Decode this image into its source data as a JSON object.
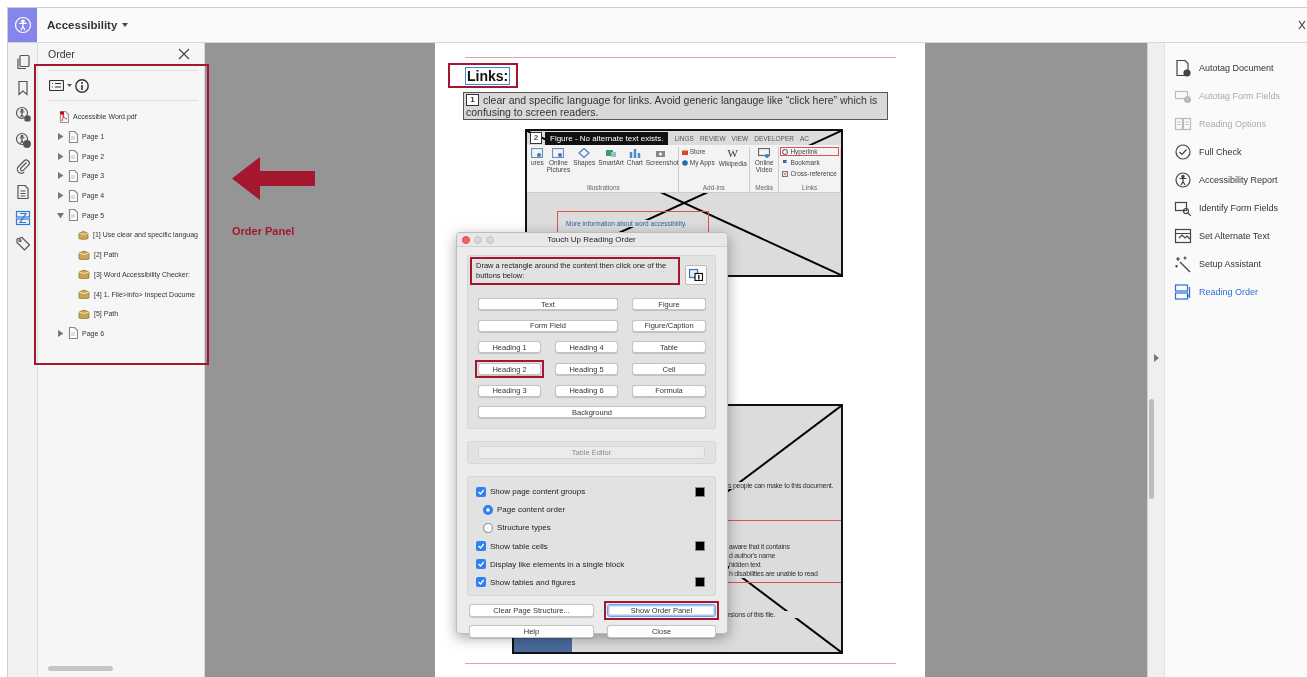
{
  "app_bar": {
    "title": "Accessibility"
  },
  "tool_rail": [
    {
      "kind": "pages",
      "selected": false
    },
    {
      "kind": "bookmarks",
      "selected": false
    },
    {
      "kind": "accessibility_tags",
      "selected": false
    },
    {
      "kind": "accessibility_check",
      "selected": false
    },
    {
      "kind": "attachments",
      "selected": false
    },
    {
      "kind": "content",
      "selected": false
    },
    {
      "kind": "order",
      "selected": true
    },
    {
      "kind": "tags",
      "selected": false
    }
  ],
  "order_panel": {
    "title": "Order",
    "highlighted": true,
    "tree": [
      {
        "kind": "file",
        "label": "Accessible Word.pdf",
        "children": [
          {
            "kind": "page",
            "label": "Page 1",
            "expanded": false
          },
          {
            "kind": "page",
            "label": "Page 2",
            "expanded": false
          },
          {
            "kind": "page",
            "label": "Page 3",
            "expanded": false
          },
          {
            "kind": "page",
            "label": "Page 4",
            "expanded": false
          },
          {
            "kind": "page",
            "label": "Page 5",
            "expanded": true,
            "children": [
              {
                "kind": "content",
                "label": "[1] Use clear and specific languag"
              },
              {
                "kind": "content",
                "label": "[2] Path"
              },
              {
                "kind": "content",
                "label": "[3] Word Accessibility Checker:"
              },
              {
                "kind": "content",
                "label": "[4] 1. File>Info> Inspect Docume"
              },
              {
                "kind": "content",
                "label": "[5] Path"
              }
            ]
          },
          {
            "kind": "page",
            "label": "Page 6",
            "expanded": false
          }
        ]
      }
    ]
  },
  "annotation": {
    "label": "Order Panel"
  },
  "document": {
    "heading": {
      "text": "Links:",
      "highlighted": true
    },
    "paragraph": {
      "number": "1",
      "text": "clear and specific language for links. Avoid generic langauge like “click here” which is confusing to screen readers."
    },
    "figure_1": {
      "number": "2",
      "tooltip": "Figure - No alternate text exists.",
      "tabs": [
        "LINGS",
        "REVIEW",
        "VIEW",
        "DEVELOPER",
        "AC"
      ],
      "groups": [
        {
          "label": "Illustrations",
          "buttons": [
            {
              "kind": "pictures",
              "label": "ures",
              "highlighted": false
            },
            {
              "kind": "pictures",
              "label": "Online Pictures",
              "highlighted": false
            },
            {
              "kind": "shapes",
              "label": "Shapes",
              "highlighted": false
            },
            {
              "kind": "smartart",
              "label": "SmartArt",
              "highlighted": false
            },
            {
              "kind": "chart",
              "label": "Chart",
              "highlighted": false
            },
            {
              "kind": "screenshot",
              "label": "Screenshot",
              "highlighted": false
            }
          ]
        },
        {
          "label": "Add-ins",
          "buttons": [
            {
              "kind": "store",
              "label": "Store",
              "highlighted": false
            },
            {
              "kind": "apps",
              "label": "My Apps",
              "highlighted": false
            },
            {
              "kind": "wikipedia",
              "glyph": "W",
              "label": "Wikipedia",
              "highlighted": false
            }
          ]
        },
        {
          "label": "Media",
          "buttons": [
            {
              "kind": "video",
              "label": "Online Video",
              "highlighted": false
            }
          ]
        },
        {
          "label": "Links",
          "buttons": [
            {
              "kind": "hyperlink",
              "label": "Hyperlink",
              "highlighted": true
            },
            {
              "kind": "bookmark",
              "label": "Bookmark",
              "highlighted": false
            },
            {
              "kind": "crossref",
              "label": "Cross-reference",
              "highlighted": false
            }
          ]
        }
      ],
      "link": "More information about word accessibility."
    },
    "figure_2": {
      "text_1": "s people can make to this document.",
      "callout": [
        "aware that it contains",
        "d author's name",
        "hidden text",
        "h disabilities are unable to read"
      ],
      "text_2": "rsions of this file."
    }
  },
  "dialog": {
    "title": "Touch Up Reading Order",
    "instruction": {
      "text": "Draw a rectangle around the content then click one of the buttons below:",
      "highlighted": true
    },
    "tag_buttons": [
      [
        {
          "label": "Text",
          "highlighted": false
        },
        {
          "label": "Figure",
          "highlighted": false
        }
      ],
      [
        {
          "label": "Form Field",
          "highlighted": false
        },
        {
          "label": "Figure/Caption",
          "highlighted": false
        }
      ],
      [
        {
          "label": "Heading 1",
          "highlighted": false
        },
        {
          "label": "Heading 4",
          "highlighted": false
        },
        {
          "label": "Table",
          "highlighted": false
        }
      ],
      [
        {
          "label": "Heading 2",
          "highlighted": true
        },
        {
          "label": "Heading 5",
          "highlighted": false
        },
        {
          "label": "Cell",
          "highlighted": false
        }
      ],
      [
        {
          "label": "Heading 3",
          "highlighted": false
        },
        {
          "label": "Heading 6",
          "highlighted": false
        },
        {
          "label": "Formula",
          "highlighted": false
        }
      ],
      [
        {
          "label": "Background",
          "highlighted": false
        }
      ]
    ],
    "table_editor": {
      "label": "Table Editor",
      "disabled": true
    },
    "options": [
      {
        "kind": "checkbox",
        "label": "Show page content groups",
        "checked": true,
        "color": "#000000"
      },
      {
        "kind": "radio",
        "label": "Page content order",
        "selected": true
      },
      {
        "kind": "radio",
        "label": "Structure types",
        "selected": false
      },
      {
        "kind": "checkbox",
        "label": "Show table cells",
        "checked": true,
        "color": "#000000"
      },
      {
        "kind": "checkbox",
        "label": "Display like elements in a single block",
        "checked": true
      },
      {
        "kind": "checkbox",
        "label": "Show tables and figures",
        "checked": true,
        "color": "#000000"
      }
    ],
    "actions": [
      {
        "label": "Clear Page Structure...",
        "highlighted": false,
        "focused": false
      },
      {
        "label": "Show Order Panel",
        "highlighted": true,
        "focused": true
      },
      {
        "label": "Help",
        "highlighted": false,
        "focused": false
      },
      {
        "label": "Close",
        "highlighted": false,
        "focused": false
      }
    ]
  },
  "tools": [
    {
      "kind": "autotag",
      "label": "Autotag Document",
      "disabled": false,
      "selected": false
    },
    {
      "kind": "autotag_fields",
      "label": "Autotag Form Fields",
      "disabled": true,
      "selected": false
    },
    {
      "kind": "reading_options",
      "label": "Reading Options",
      "disabled": true,
      "selected": false
    },
    {
      "kind": "full_check",
      "label": "Full Check",
      "disabled": false,
      "selected": false
    },
    {
      "kind": "report",
      "label": "Accessibility Report",
      "disabled": false,
      "selected": false
    },
    {
      "kind": "identify_fields",
      "label": "Identify Form Fields",
      "disabled": false,
      "selected": false
    },
    {
      "kind": "alt_text",
      "label": "Set Alternate Text",
      "disabled": false,
      "selected": false
    },
    {
      "kind": "setup",
      "label": "Setup Assistant",
      "disabled": false,
      "selected": false
    },
    {
      "kind": "reading_order",
      "label": "Reading Order",
      "disabled": false,
      "selected": true
    }
  ]
}
